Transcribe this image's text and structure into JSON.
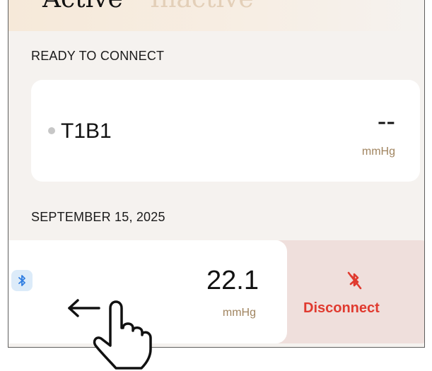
{
  "segment": {
    "active_label": "Active",
    "inactive_label": "Inactive"
  },
  "ready_section": {
    "title": "READY TO CONNECT",
    "device": {
      "name": "T1B1",
      "status": "offline",
      "value": "--",
      "unit": "mmHg"
    }
  },
  "date_section": {
    "title": "SEPTEMBER 15, 2025",
    "device": {
      "icon": "bluetooth-icon",
      "value": "22.1",
      "unit": "mmHg"
    },
    "swipe_action": {
      "icon": "bluetooth-off-icon",
      "label": "Disconnect",
      "color": "#e03a2f"
    }
  },
  "gesture": {
    "arrow_icon": "arrow-left-icon",
    "hand_icon": "hand-swipe-icon"
  },
  "colors": {
    "background": "#f5f2ef",
    "card": "#ffffff",
    "unit_text": "#a0845f",
    "disconnect_bg": "#efdfdc",
    "bluetooth": "#2f7de1"
  }
}
